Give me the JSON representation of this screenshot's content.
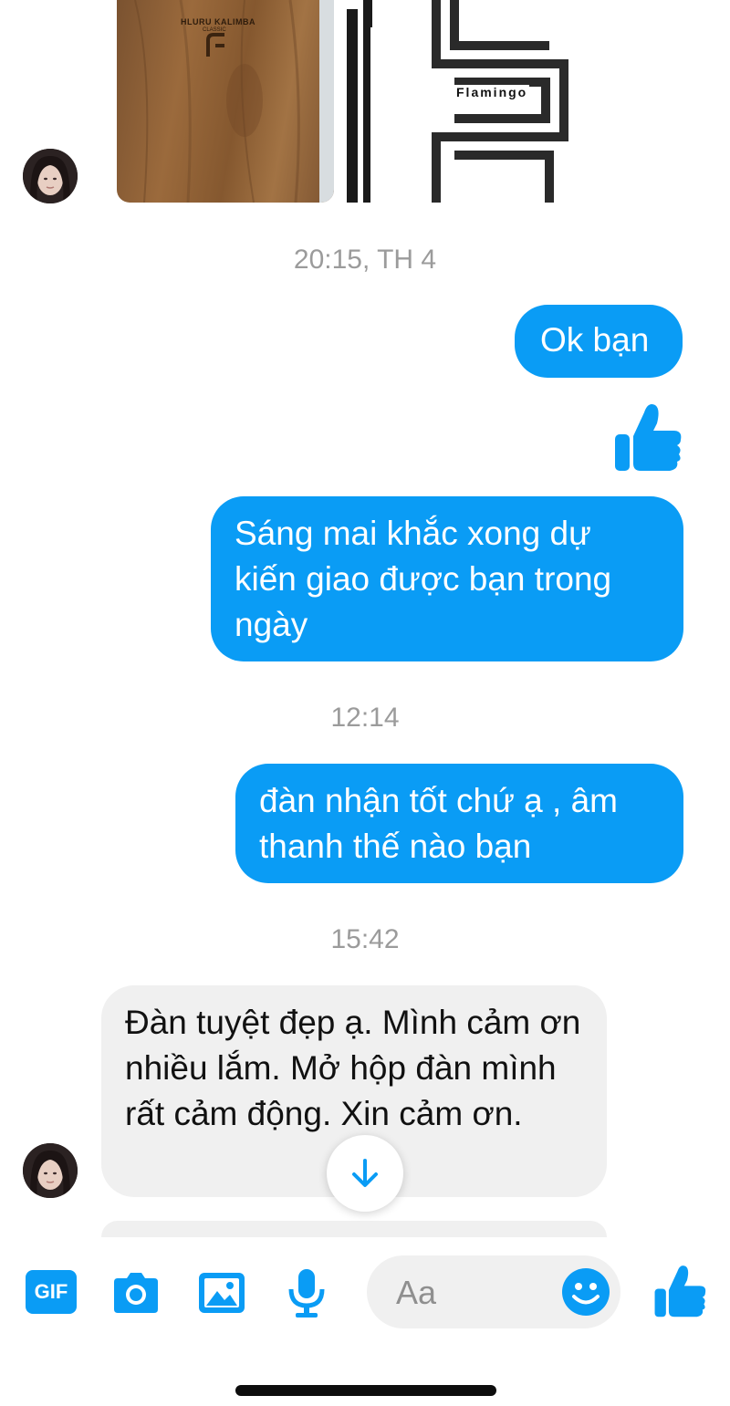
{
  "colors": {
    "accent": "#0a9cf5",
    "incoming_bubble": "#f0f0f0",
    "timestamp": "#9b9b9b"
  },
  "shared_images": {
    "photo_engraving": "HLURU KALIMBA",
    "photo_engraving_sub": "CLASSIC",
    "logo_text": "Flamingo"
  },
  "messages": [
    {
      "type": "timestamp",
      "text": "20:15, TH 4"
    },
    {
      "type": "outgoing",
      "text": "Ok bạn"
    },
    {
      "type": "outgoing-like",
      "icon": "thumbs-up-icon"
    },
    {
      "type": "outgoing",
      "text": "Sáng mai khắc xong dự kiến giao được bạn trong ngày"
    },
    {
      "type": "timestamp",
      "text": "12:14"
    },
    {
      "type": "outgoing",
      "text": "đàn nhận tốt chứ ạ , âm thanh thế nào bạn"
    },
    {
      "type": "timestamp",
      "text": "15:42"
    },
    {
      "type": "incoming",
      "text": "Đàn tuyệt đẹp ạ. Mình cảm ơn nhiều lắm. Mở hộp đàn mình rất cảm động. Xin cảm ơn."
    }
  ],
  "composer": {
    "placeholder": "Aa",
    "icons": [
      "gif-icon",
      "camera-icon",
      "image-icon",
      "microphone-icon",
      "emoji-icon",
      "thumbs-up-icon"
    ],
    "gif_label": "GIF"
  },
  "scroll_down_icon": "arrow-down-icon"
}
